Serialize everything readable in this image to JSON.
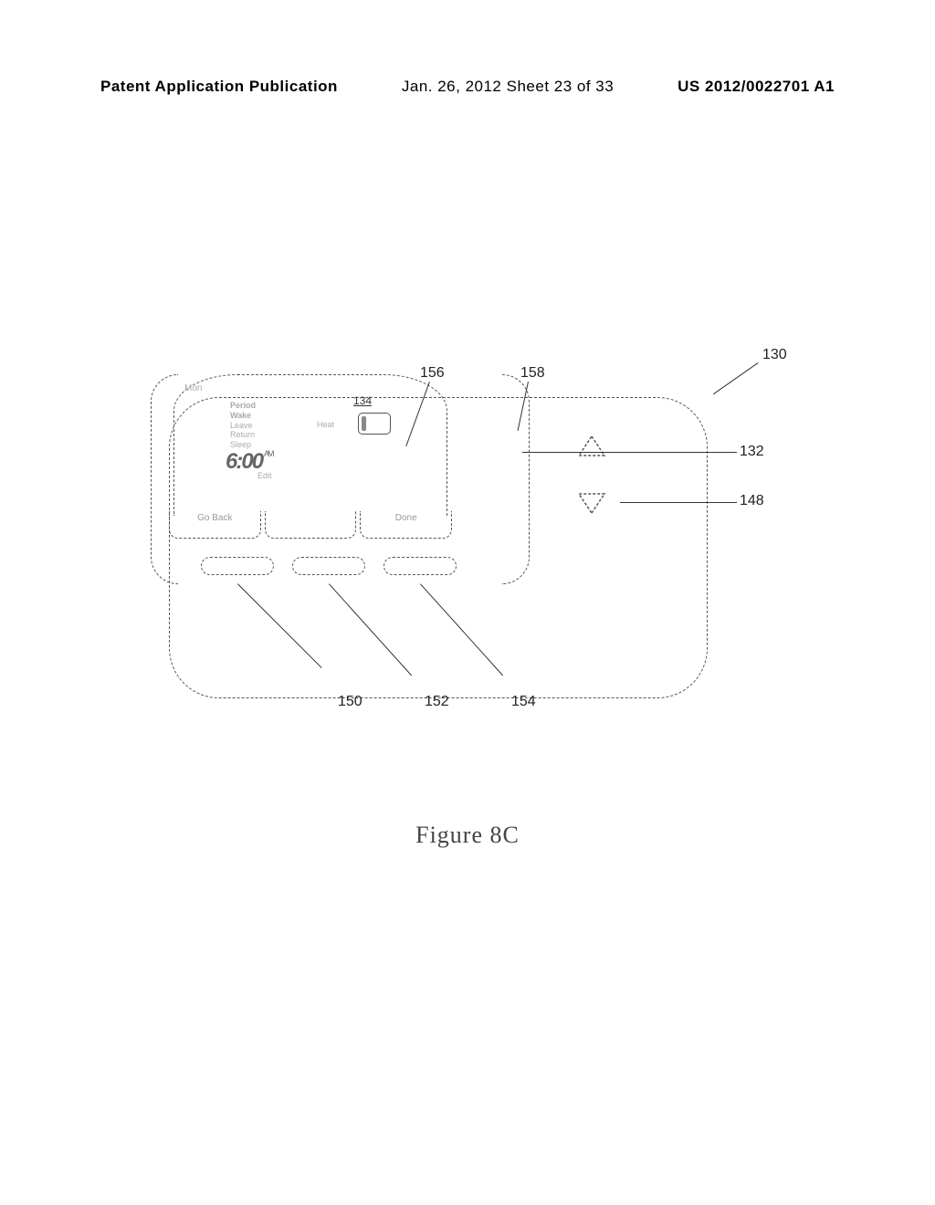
{
  "header": {
    "left": "Patent Application Publication",
    "center": "Jan. 26, 2012  Sheet 23 of 33",
    "right": "US 2012/0022701 A1"
  },
  "figure": {
    "caption": "Figure 8C"
  },
  "refs": {
    "r130": "130",
    "r132": "132",
    "r134": "134",
    "r148": "148",
    "r150": "150",
    "r152": "152",
    "r154": "154",
    "r156": "156",
    "r158": "158"
  },
  "thermostat": {
    "day": "Mon",
    "period_title": "Period",
    "period_current": "Wake",
    "period2": "Leave",
    "period3": "Return",
    "period4": "Sleep",
    "mode": "Heat",
    "time": "6:00",
    "ampm": "AM",
    "edit": "Edit",
    "soft_left": "Go Back",
    "soft_mid": "",
    "soft_right": "Done",
    "ref134": "134"
  }
}
